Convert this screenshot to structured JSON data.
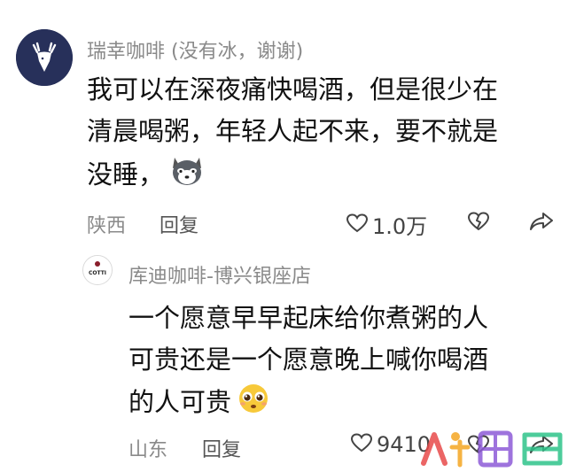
{
  "comment": {
    "author": "瑞幸咖啡 (没有冰，谢谢)",
    "text_lines": [
      "我可以在深夜痛快喝酒，但是很少在",
      "清晨喝粥，年轻人起不来，要不就是",
      "没睡，"
    ],
    "emoji_icon": "husky-dog-emoji-icon",
    "location": "陕西",
    "reply_label": "回复",
    "like_count": "1.0万"
  },
  "reply": {
    "author": "库迪咖啡-博兴银座店",
    "avatar_text": "COTTI",
    "text_lines": [
      "一个愿意早早起床给你煮粥的人",
      "可贵还是一个愿意晚上喊你喝酒",
      "的人可贵"
    ],
    "emoji_icon": "pleading-face-emoji-icon",
    "location": "山东",
    "reply_label": "回复",
    "like_count": "9410"
  },
  "watermark": {
    "text": "人人都是",
    "colors": [
      "#e84b4b",
      "#f5a623",
      "#8e5bd8",
      "#2ec48a"
    ]
  },
  "icons": [
    "heart-icon",
    "dislike-heart-icon",
    "share-icon"
  ]
}
